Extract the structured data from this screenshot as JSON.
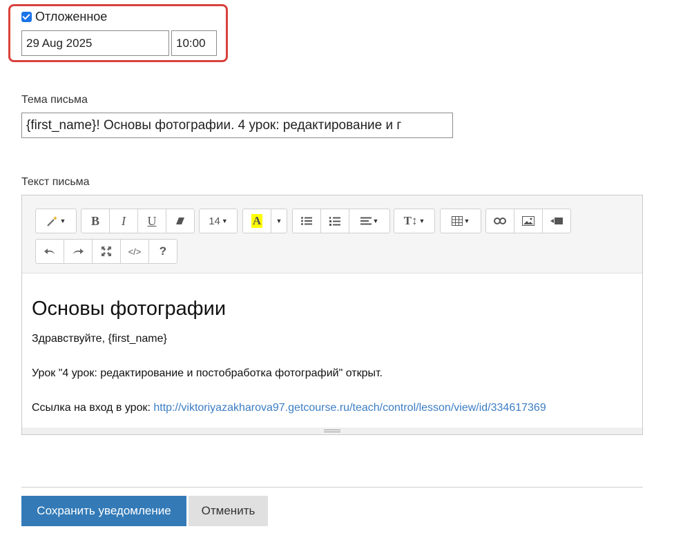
{
  "schedule": {
    "delayed_label": "Отложенное",
    "delayed_checked": true,
    "date_value": "29 Aug 2025",
    "time_value": "10:00"
  },
  "subject": {
    "label": "Тема письма",
    "value": "{first_name}! Основы фотографии. 4 урок: редактирование и г"
  },
  "body": {
    "label": "Текст письма",
    "toolbar": {
      "font_size": "14",
      "help_label": "?",
      "code_label": "</>"
    },
    "heading": "Основы фотографии",
    "greeting": "Здравствуйте, {first_name}",
    "lesson_line": "Урок \"4 урок: редактирование и постобработка фотографий\" открыт.",
    "link_prefix": "Ссылка на вход в урок: ",
    "link_url": "http://viktoriyazakharova97.getcourse.ru/teach/control/lesson/view/id/334617369"
  },
  "actions": {
    "save_label": "Сохранить уведомление",
    "cancel_label": "Отменить"
  },
  "colors": {
    "highlight_box": "#d9413b",
    "primary": "#337ab7",
    "link": "#3b7dc4",
    "highlight_yellow": "#ffff00"
  }
}
